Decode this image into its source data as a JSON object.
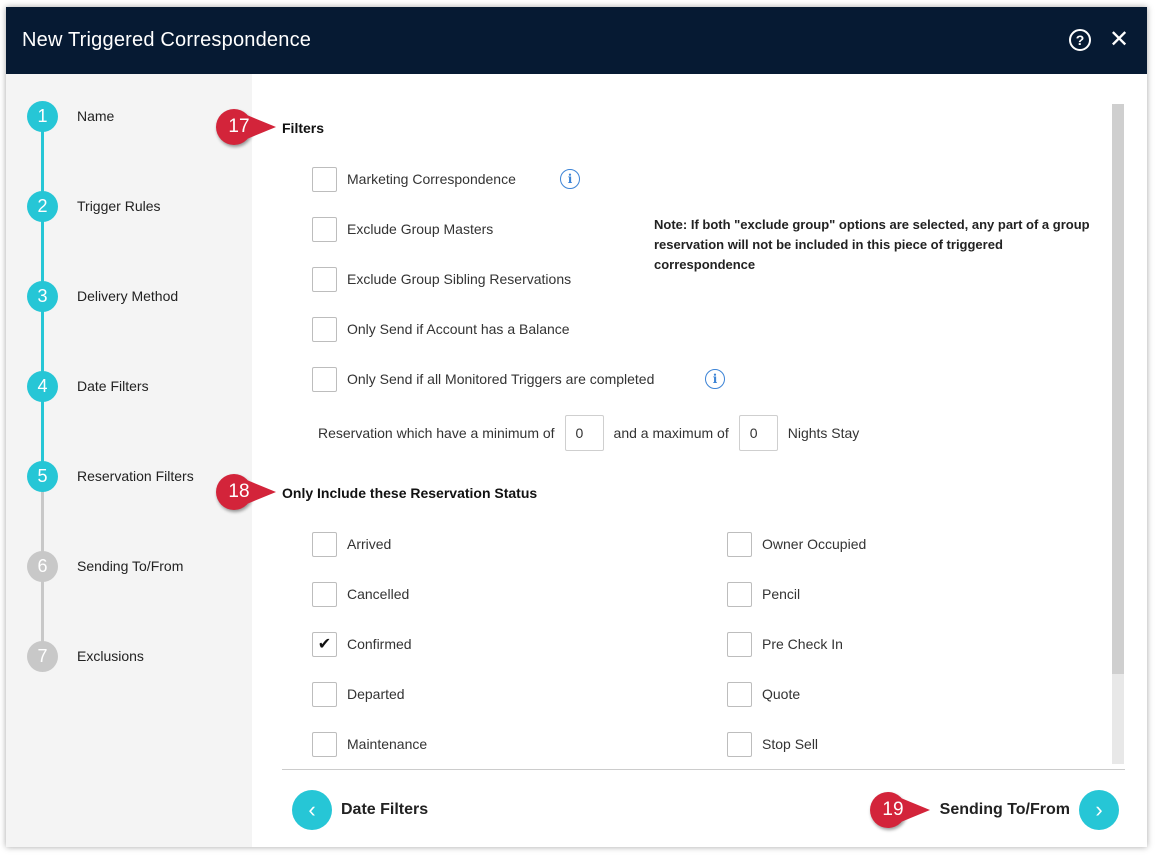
{
  "dialog": {
    "title": "New Triggered Correspondence",
    "help_icon": "?",
    "close_icon": "✕"
  },
  "steps": [
    {
      "num": "1",
      "label": "Name",
      "state": "active"
    },
    {
      "num": "2",
      "label": "Trigger Rules",
      "state": "active"
    },
    {
      "num": "3",
      "label": "Delivery Method",
      "state": "active"
    },
    {
      "num": "4",
      "label": "Date Filters",
      "state": "active"
    },
    {
      "num": "5",
      "label": "Reservation Filters",
      "state": "active"
    },
    {
      "num": "6",
      "label": "Sending To/From",
      "state": "inactive"
    },
    {
      "num": "7",
      "label": "Exclusions",
      "state": "inactive"
    }
  ],
  "badges": {
    "filters": "17",
    "status": "18",
    "next": "19"
  },
  "filters": {
    "title": "Filters",
    "items": [
      {
        "label": "Marketing Correspondence",
        "checked": false
      },
      {
        "label": "Exclude Group Masters",
        "checked": false
      },
      {
        "label": "Exclude Group Sibling Reservations",
        "checked": false
      },
      {
        "label": "Only Send if Account has a Balance",
        "checked": false
      },
      {
        "label": "Only Send if all Monitored Triggers are completed",
        "checked": false
      }
    ],
    "note": "Note: If both \"exclude group\" options are selected, any part of a group reservation will not be included in this piece of triggered correspondence",
    "nights": {
      "prefix": "Reservation which have a minimum of",
      "min_value": "0",
      "middle": "and a maximum of",
      "max_value": "0",
      "suffix": "Nights Stay"
    }
  },
  "status": {
    "title": "Only Include these Reservation Status",
    "left": [
      {
        "label": "Arrived",
        "checked": false
      },
      {
        "label": "Cancelled",
        "checked": false
      },
      {
        "label": "Confirmed",
        "checked": true
      },
      {
        "label": "Departed",
        "checked": false
      },
      {
        "label": "Maintenance",
        "checked": false
      }
    ],
    "right": [
      {
        "label": "Owner Occupied",
        "checked": false
      },
      {
        "label": "Pencil",
        "checked": false
      },
      {
        "label": "Pre Check In",
        "checked": false
      },
      {
        "label": "Quote",
        "checked": false
      },
      {
        "label": "Stop Sell",
        "checked": false
      }
    ]
  },
  "footer": {
    "back_label": "Date Filters",
    "next_label": "Sending To/From"
  },
  "colors": {
    "accent": "#26c6d6",
    "header": "#061a33",
    "badge": "#d3243a",
    "inactive": "#c8c8c8"
  }
}
